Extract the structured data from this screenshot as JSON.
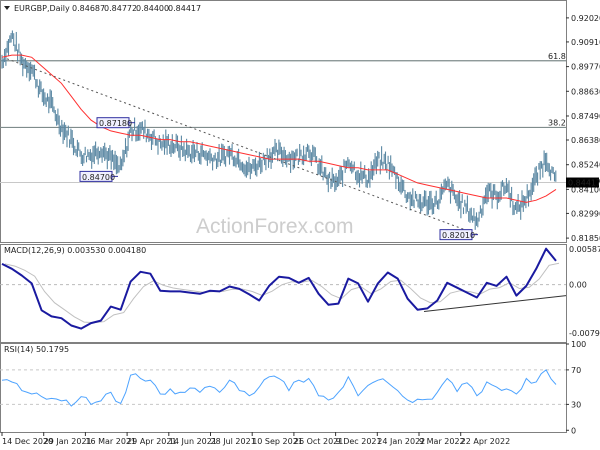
{
  "chart_data": [
    {
      "type": "ohlc-bar",
      "title": "EURGBP,Daily",
      "ohlc_readout": {
        "open": "0.84687",
        "high": "0.84772",
        "low": "0.84400",
        "close": "0.84417"
      },
      "ylim": [
        0.8167,
        0.928
      ],
      "yticks": [
        "0.92020",
        "0.90910",
        "0.89770",
        "0.88630",
        "0.87490",
        "0.86380",
        "0.85240",
        "0.84100",
        "0.82990",
        "0.81850"
      ],
      "current_price_label": "0.84417",
      "current_price": 0.84417,
      "close_samples": [
        0.9,
        0.912,
        0.9,
        0.897,
        0.885,
        0.88,
        0.87,
        0.864,
        0.857,
        0.857,
        0.86,
        0.855,
        0.85,
        0.868,
        0.869,
        0.866,
        0.862,
        0.862,
        0.86,
        0.858,
        0.858,
        0.856,
        0.855,
        0.858,
        0.855,
        0.85,
        0.853,
        0.857,
        0.858,
        0.856,
        0.856,
        0.86,
        0.852,
        0.845,
        0.844,
        0.855,
        0.848,
        0.846,
        0.854,
        0.853,
        0.846,
        0.838,
        0.835,
        0.835,
        0.835,
        0.843,
        0.836,
        0.832,
        0.826,
        0.84,
        0.838,
        0.843,
        0.831,
        0.837,
        0.846,
        0.856,
        0.844
      ],
      "moving_average_samples": [
        0.902,
        0.903,
        0.903,
        0.902,
        0.898,
        0.894,
        0.89,
        0.884,
        0.878,
        0.873,
        0.87,
        0.868,
        0.867,
        0.866,
        0.866,
        0.865,
        0.864,
        0.864,
        0.863,
        0.863,
        0.862,
        0.861,
        0.86,
        0.859,
        0.858,
        0.857,
        0.856,
        0.855,
        0.855,
        0.855,
        0.855,
        0.854,
        0.854,
        0.853,
        0.852,
        0.851,
        0.851,
        0.85,
        0.85,
        0.85,
        0.848,
        0.846,
        0.844,
        0.843,
        0.842,
        0.841,
        0.84,
        0.839,
        0.838,
        0.837,
        0.837,
        0.837,
        0.836,
        0.835,
        0.836,
        0.838,
        0.841
      ],
      "ma_color": "#ff3030",
      "bar_color": "#5b88a3",
      "fib_levels": [
        {
          "label": "61.8",
          "value": 0.9004
        },
        {
          "label": "38.2",
          "value": 0.8696
        }
      ],
      "trendline": {
        "start": 0.9013,
        "end": 0.8201,
        "style": "dotted"
      },
      "price_labels": [
        {
          "text": "0.87180",
          "value": 0.8718
        },
        {
          "text": "0.84700",
          "value": 0.847
        },
        {
          "text": "0.82010",
          "value": 0.8201
        }
      ],
      "watermark": "ActionForex.com"
    },
    {
      "type": "line",
      "title": "MACD(12,26,9) 0.003530 0.004180",
      "ylim": [
        -0.0094,
        0.0065
      ],
      "yticks": [
        "0.005872",
        "0.00",
        "-0.007945"
      ],
      "macd_samples": [
        0.0034,
        0.0026,
        0.0015,
        0.0002,
        -0.0042,
        -0.0052,
        -0.0055,
        -0.0067,
        -0.0072,
        -0.0063,
        -0.0059,
        -0.0036,
        -0.0041,
        0.0005,
        0.0021,
        0.0018,
        -0.001,
        -0.0011,
        -0.0011,
        -0.0013,
        -0.0015,
        -0.001,
        -0.0011,
        -0.0003,
        -0.0007,
        -0.0016,
        -0.0026,
        -0.0002,
        0.0013,
        0.0011,
        0.0003,
        0.0011,
        -0.0015,
        -0.0033,
        -0.0031,
        0.001,
        0.0002,
        -0.0028,
        0.0002,
        0.002,
        0.001,
        -0.0023,
        -0.0041,
        -0.0039,
        -0.0026,
        0.0003,
        -0.0005,
        -0.0013,
        -0.0021,
        0.0003,
        -0.0002,
        0.0013,
        -0.0018,
        -0.0002,
        0.0026,
        0.0059,
        0.0039
      ],
      "macd_color": "#1a1aa0",
      "signal_color": "#c0c0c0",
      "trendline": {
        "start": -0.0044,
        "end": -0.0018
      }
    },
    {
      "type": "line",
      "title": "RSI(14) 50.1795",
      "ylim": [
        -2,
        100
      ],
      "yticks": [
        "100",
        "70",
        "30",
        "0"
      ],
      "levels": [
        70,
        30
      ],
      "rsi_samples": [
        58,
        56,
        46,
        42,
        39,
        37,
        34,
        28,
        39,
        30,
        34,
        44,
        31,
        64,
        60,
        58,
        42,
        48,
        44,
        49,
        44,
        51,
        44,
        58,
        46,
        40,
        50,
        62,
        60,
        46,
        58,
        60,
        40,
        35,
        44,
        62,
        40,
        52,
        58,
        55,
        46,
        35,
        36,
        36,
        44,
        60,
        45,
        55,
        40,
        56,
        50,
        48,
        42,
        60,
        56,
        70,
        53
      ],
      "rsi_color": "#4da3ff"
    }
  ],
  "x_axis": {
    "ticks": [
      "14 Dec 2020",
      "29 Jan 2021",
      "16 Mar 2021",
      "29 Apr 2021",
      "14 Jun 2021",
      "28 Jul 2021",
      "10 Sep 2021",
      "26 Oct 2021",
      "9 Dec 2021",
      "24 Jan 2022",
      "9 Mar 2022",
      "22 Apr 2022"
    ]
  }
}
